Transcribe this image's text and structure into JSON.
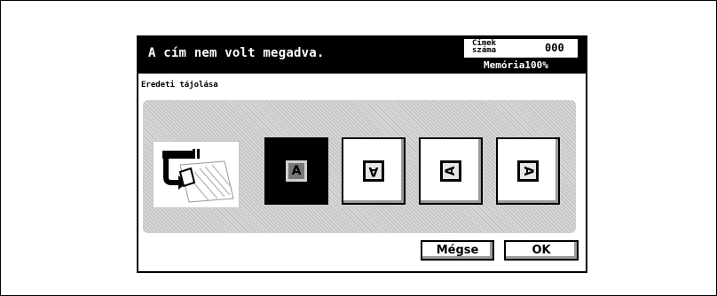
{
  "header": {
    "message": "A cím nem volt megadva.",
    "count_label": "Címek száma",
    "count_value": "000",
    "memory": "Memória100%"
  },
  "section": {
    "label": "Eredeti tájolása"
  },
  "orientations": [
    {
      "glyph": "A",
      "selected": true
    },
    {
      "glyph": "A",
      "selected": false
    },
    {
      "glyph": "A",
      "selected": false
    },
    {
      "glyph": "A",
      "selected": false
    }
  ],
  "buttons": {
    "cancel": "Mégse",
    "ok": "OK"
  }
}
